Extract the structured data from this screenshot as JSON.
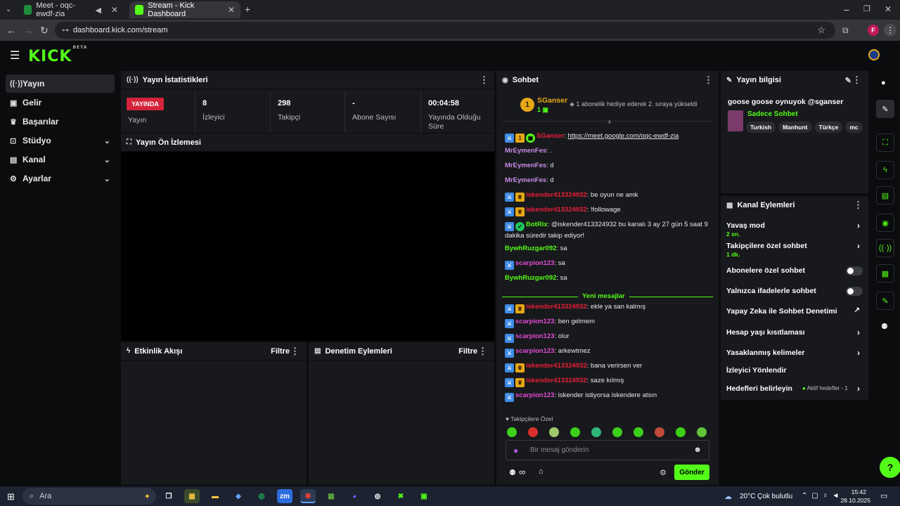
{
  "browser": {
    "tabs": [
      {
        "title": "Meet - oqc-ewdf-zia"
      },
      {
        "title": "Stream - Kick Dashboard"
      }
    ],
    "address": "dashboard.kick.com/stream",
    "profile_initial": "F"
  },
  "brand": {
    "logo": "KICK",
    "beta": "BETA",
    "accent": "#53fc18"
  },
  "sidebar": {
    "items": [
      {
        "label": "Yayın",
        "icon": "broadcast-icon"
      },
      {
        "label": "Gelir",
        "icon": "wallet-icon"
      },
      {
        "label": "Başarılar",
        "icon": "trophy-icon"
      },
      {
        "label": "Stüdyo",
        "icon": "studio-icon"
      },
      {
        "label": "Kanal",
        "icon": "channel-icon"
      },
      {
        "label": "Ayarlar",
        "icon": "gear-icon"
      }
    ]
  },
  "stats": {
    "title": "Yayın İstatistikleri",
    "live_badge": "YAYINDA",
    "live_label": "Yayın",
    "viewers_value": "8",
    "viewers_label": "İzleyici",
    "followers_value": "298",
    "followers_label": "Takipçi",
    "subs_value": "-",
    "subs_label": "Abone Sayısı",
    "uptime_value": "00:04:58",
    "uptime_label": "Yayında Olduğu Süre"
  },
  "preview": {
    "title": "Yayın Ön İzlemesi"
  },
  "activity": {
    "title": "Etkinlik Akışı",
    "filter": "Filtre"
  },
  "moderation": {
    "title": "Denetim Eylemleri",
    "filter": "Filtre"
  },
  "chat": {
    "title": "Sohbet",
    "pinned_user": "SGanser",
    "pinned_rank": "1",
    "pinned_count": "1",
    "pinned_text": "1 abonelik hediye ederek 2. sıraya yükseldi",
    "new_messages": "Yeni mesajlar",
    "messages": [
      {
        "user": "SGanser",
        "text": "https://meet.google.com/oqc-ewdf-zia"
      },
      {
        "user": "MrEymenFes",
        "text": "."
      },
      {
        "user": "MrEymenFes",
        "text": "d"
      },
      {
        "user": "MrEymenFes",
        "text": "d"
      },
      {
        "user": "iskender413324932",
        "text": "be oyun ne amk"
      },
      {
        "user": "iskender413324932",
        "text": "!followage"
      },
      {
        "user": "BotRix",
        "text": "@iskender413324932 bu kanalı 3 ay 27 gün 5 saat 9 dakika süredir takip ediyor!"
      },
      {
        "user": "BywhRuzgar092",
        "text": "sa"
      },
      {
        "user": "scarpion123",
        "text": "sa"
      },
      {
        "user": "BywhRuzgar092",
        "text": "sa"
      },
      {
        "user": "iskender413324932",
        "text": "ekle ya san kalmış"
      },
      {
        "user": "scarpion123",
        "text": "ben gelmem"
      },
      {
        "user": "scarpion123",
        "text": "olur"
      },
      {
        "user": "scarpion123",
        "text": "arkewtmez"
      },
      {
        "user": "iskender413324932",
        "text": "bana verirsen ver"
      },
      {
        "user": "iskender413324932",
        "text": "saze kılmış"
      },
      {
        "user": "scarpion123",
        "text": "iskender istiyorsa iskendere atsın"
      }
    ],
    "followers_only": "Takipçilere Özel",
    "placeholder": "Bir mesaj gönderin",
    "send": "Gönder",
    "infinity": "∞"
  },
  "stream_info": {
    "title": "Yayın bilgisi",
    "stream_title": "goose goose oynuyok @sganser",
    "category": "Sadece Sohbet",
    "tags": [
      "Turkish",
      "Manhunt",
      "Türkçe",
      "mc"
    ]
  },
  "channel_actions": {
    "title": "Kanal Eylemleri",
    "items": [
      {
        "label": "Yavaş mod",
        "sub": "2 sn."
      },
      {
        "label": "Takipçilere özel sohbet",
        "sub": "1 dk."
      },
      {
        "label": "Abonelere özel sohbet"
      },
      {
        "label": "Yalnızca ifadelerle sohbet"
      },
      {
        "label": "Yapay Zeka ile Sohbet Denetimi"
      },
      {
        "label": "Hesap yaşı kısıtlaması"
      },
      {
        "label": "Yasaklanmış kelimeler"
      },
      {
        "label": "İzleyici Yönlendir"
      },
      {
        "label": "Hedefleri belirleyin",
        "sub": "Aktif hedefler - 1"
      }
    ]
  },
  "taskbar": {
    "search": "Ara",
    "weather": "20°C  Çok bulutlu",
    "time": "15:42",
    "date": "28.10.2025"
  }
}
